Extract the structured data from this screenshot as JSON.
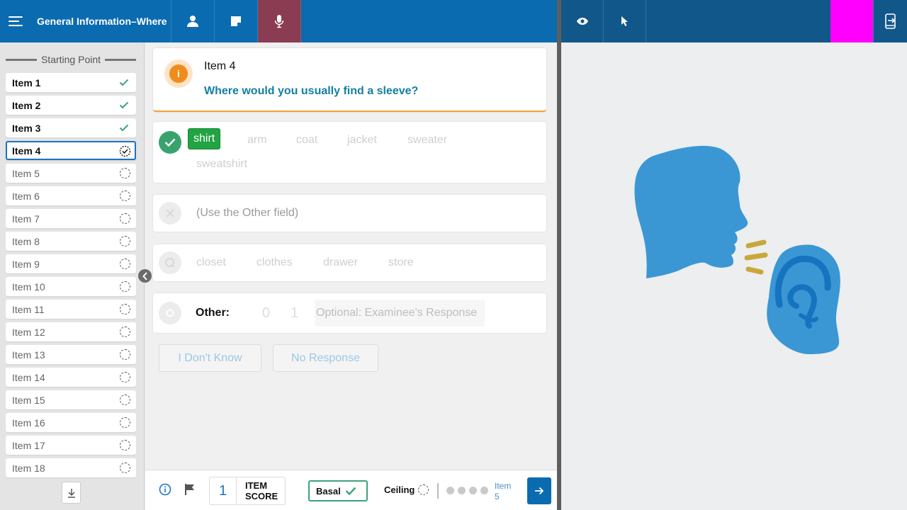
{
  "header": {
    "title": "General Information–Where",
    "menu_icon": "hamburger-menu-icon",
    "tabs": [
      {
        "name": "examinee",
        "icon": "person-icon",
        "active": false
      },
      {
        "name": "notes",
        "icon": "note-icon",
        "active": false
      },
      {
        "name": "microphone",
        "icon": "microphone-icon",
        "active": true
      }
    ],
    "accent_color": "#0b6bb0",
    "active_tab_color": "#8a3c52"
  },
  "right_header": {
    "buttons": [
      {
        "name": "preview",
        "icon": "eye-icon"
      },
      {
        "name": "pointer",
        "icon": "cursor-icon"
      }
    ],
    "highlight_color": "#ff00ff",
    "exit_icon": "exit-device-icon"
  },
  "sidebar": {
    "heading": "Starting Point",
    "items": [
      {
        "label": "Item 1",
        "status": "done"
      },
      {
        "label": "Item 2",
        "status": "done"
      },
      {
        "label": "Item 3",
        "status": "done"
      },
      {
        "label": "Item 4",
        "status": "current"
      },
      {
        "label": "Item 5",
        "status": "pending"
      },
      {
        "label": "Item 6",
        "status": "pending"
      },
      {
        "label": "Item 7",
        "status": "pending"
      },
      {
        "label": "Item 8",
        "status": "pending"
      },
      {
        "label": "Item 9",
        "status": "pending"
      },
      {
        "label": "Item 10",
        "status": "pending"
      },
      {
        "label": "Item 11",
        "status": "pending"
      },
      {
        "label": "Item 12",
        "status": "pending"
      },
      {
        "label": "Item 13",
        "status": "pending"
      },
      {
        "label": "Item 14",
        "status": "pending"
      },
      {
        "label": "Item 15",
        "status": "pending"
      },
      {
        "label": "Item 16",
        "status": "pending"
      },
      {
        "label": "Item 17",
        "status": "pending"
      },
      {
        "label": "Item 18",
        "status": "pending"
      }
    ]
  },
  "question": {
    "item": "Item 4",
    "text": "Where would you usually find a sleeve?",
    "icon": "info-icon"
  },
  "responses": {
    "correct": {
      "words": [
        "shirt",
        "arm",
        "coat",
        "jacket",
        "sweater",
        "sweatshirt"
      ],
      "selected": "shirt"
    },
    "incorrect": {
      "text": "(Use the Other field)"
    },
    "query": {
      "words": [
        "closet",
        "clothes",
        "drawer",
        "store"
      ]
    },
    "other": {
      "label": "Other:",
      "scores": [
        "0",
        "1"
      ],
      "placeholder": "Optional: Examinee's Response"
    },
    "buttons": {
      "dont_know": "I Don't Know",
      "no_response": "No Response"
    }
  },
  "bottom": {
    "item_score": "1",
    "item_score_label_1": "ITEM",
    "item_score_label_2": "SCORE",
    "basal": "Basal",
    "ceiling": "Ceiling",
    "next_label_1": "Item",
    "next_label_2": "5"
  },
  "illustration": {
    "description_icon": "speaking-head-and-ear-illustration",
    "head_color": "#3a97d4",
    "sound_color": "#c9a73a"
  }
}
